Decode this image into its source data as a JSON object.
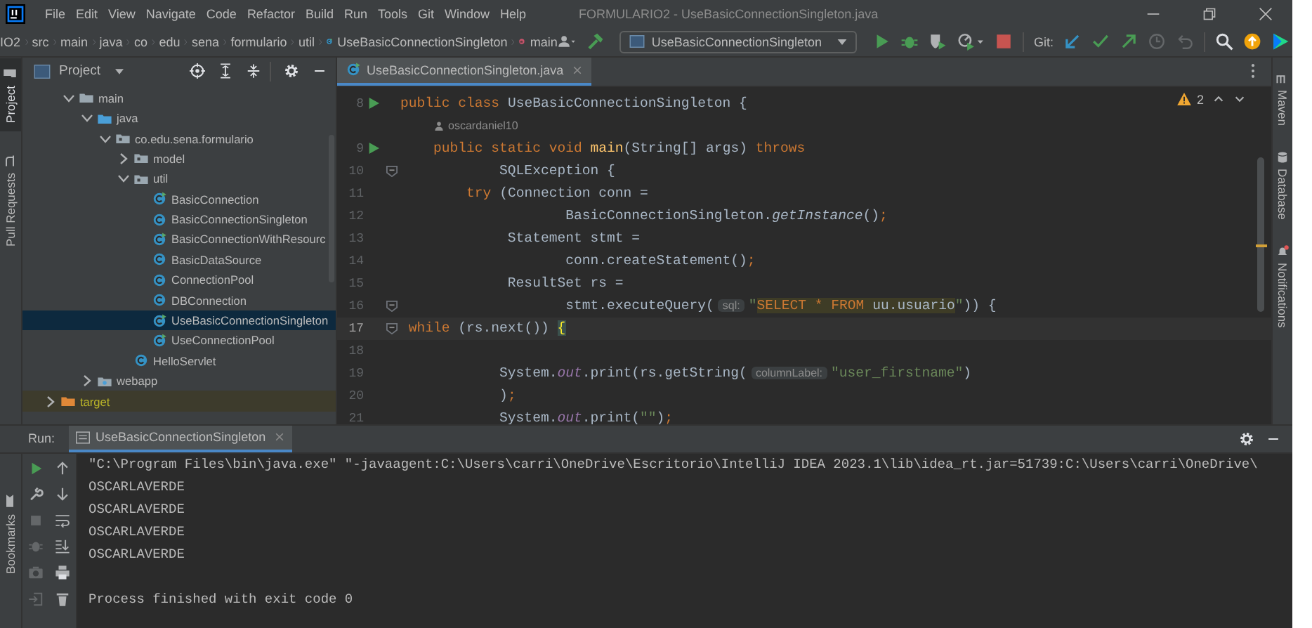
{
  "window": {
    "title": "FORMULARIO2 - UseBasicConnectionSingleton.java"
  },
  "menu": [
    "File",
    "Edit",
    "View",
    "Navigate",
    "Code",
    "Refactor",
    "Build",
    "Run",
    "Tools",
    "Git",
    "Window",
    "Help"
  ],
  "breadcrumbs": [
    {
      "label": "IO2",
      "kind": "path"
    },
    {
      "label": "src",
      "kind": "path"
    },
    {
      "label": "main",
      "kind": "path"
    },
    {
      "label": "java",
      "kind": "path"
    },
    {
      "label": "co",
      "kind": "path"
    },
    {
      "label": "edu",
      "kind": "path"
    },
    {
      "label": "sena",
      "kind": "path"
    },
    {
      "label": "formulario",
      "kind": "path"
    },
    {
      "label": "util",
      "kind": "path"
    },
    {
      "label": "UseBasicConnectionSingleton",
      "kind": "class"
    },
    {
      "label": "main",
      "kind": "method"
    }
  ],
  "run_config": {
    "label": "UseBasicConnectionSingleton"
  },
  "git": {
    "label": "Git:",
    "actions": [
      {
        "kind": "update",
        "disabled": false
      },
      {
        "kind": "commit",
        "disabled": false
      },
      {
        "kind": "push",
        "disabled": false
      },
      {
        "kind": "history",
        "disabled": true
      },
      {
        "kind": "rollback",
        "disabled": true
      }
    ]
  },
  "left_stripe": [
    {
      "label": "Project",
      "kind": "project",
      "selected": true
    },
    {
      "label": "Pull Requests",
      "kind": "pull_requests",
      "selected": false
    }
  ],
  "project": {
    "title": "Project",
    "tree": [
      {
        "children": [
          {
            "label": "main",
            "kind": "folder",
            "expanded": true,
            "selected": false,
            "children": [
              {
                "label": "java",
                "kind": "source_folder",
                "expanded": true,
                "selected": false,
                "children": [
                  {
                    "label": "co.edu.sena.formulario",
                    "kind": "package",
                    "expanded": true,
                    "selected": false,
                    "children": [
                      {
                        "label": "model",
                        "kind": "package",
                        "expanded": false,
                        "selected": false
                      },
                      {
                        "label": "util",
                        "kind": "package",
                        "expanded": true,
                        "selected": false,
                        "children": [
                          {
                            "label": "BasicConnection",
                            "kind": "runnable_class",
                            "selected": false
                          },
                          {
                            "label": "BasicConnectionSingleton",
                            "kind": "class",
                            "selected": false
                          },
                          {
                            "label": "BasicConnectionWithResourc",
                            "kind": "runnable_class",
                            "selected": false
                          },
                          {
                            "label": "BasicDataSource",
                            "kind": "class",
                            "selected": false
                          },
                          {
                            "label": "ConnectionPool",
                            "kind": "class",
                            "selected": false
                          },
                          {
                            "label": "DBConnection",
                            "kind": "class",
                            "selected": false
                          },
                          {
                            "label": "UseBasicConnectionSingleton",
                            "kind": "runnable_class",
                            "selected": true
                          },
                          {
                            "label": "UseConnectionPool",
                            "kind": "runnable_class",
                            "selected": false
                          }
                        ]
                      },
                      {
                        "label": "HelloServlet",
                        "kind": "class",
                        "selected": false
                      }
                    ]
                  }
                ]
              },
              {
                "label": "webapp",
                "kind": "web_folder",
                "expanded": false,
                "selected": false
              }
            ]
          }
        ]
      },
      {
        "label": "target",
        "kind": "excluded_folder",
        "expanded": false,
        "selected": false
      }
    ]
  },
  "editor": {
    "tabs": [
      {
        "label": "UseBasicConnectionSingleton.java",
        "selected": true
      }
    ],
    "warnings": "2",
    "lines": [
      {
        "kind": "code",
        "number": "8",
        "run": true,
        "fold": false,
        "current": false,
        "tokens": [
          {
            "text": "public class ",
            "kind": "kw"
          },
          {
            "text": "UseBasicConnectionSingleton {",
            "kind": "plain"
          }
        ]
      },
      {
        "kind": "author",
        "text": "oscardaniel10"
      },
      {
        "kind": "code",
        "number": "9",
        "run": true,
        "fold": false,
        "current": false,
        "tokens": [
          {
            "text": "    public static void ",
            "kind": "kw"
          },
          {
            "text": "main",
            "kind": "method"
          },
          {
            "text": "(String[] args) ",
            "kind": "plain"
          },
          {
            "text": "throws",
            "kind": "kw"
          }
        ]
      },
      {
        "kind": "code",
        "number": "10",
        "run": false,
        "fold": true,
        "current": false,
        "tokens": [
          {
            "text": "            SQLException {",
            "kind": "plain"
          }
        ]
      },
      {
        "kind": "code",
        "number": "11",
        "run": false,
        "fold": false,
        "current": false,
        "tokens": [
          {
            "text": "        try ",
            "kind": "kw"
          },
          {
            "text": "(Connection conn =",
            "kind": "plain"
          }
        ]
      },
      {
        "kind": "code",
        "number": "12",
        "run": false,
        "fold": false,
        "current": false,
        "tokens": [
          {
            "text": "                    BasicConnectionSingleton.",
            "kind": "plain"
          },
          {
            "text": "getInstance",
            "kind": "italic"
          },
          {
            "text": "()",
            "kind": "plain"
          },
          {
            "text": ";",
            "kind": "kw"
          }
        ]
      },
      {
        "kind": "code",
        "number": "13",
        "run": false,
        "fold": false,
        "current": false,
        "tokens": [
          {
            "text": "             Statement stmt =",
            "kind": "plain"
          }
        ]
      },
      {
        "kind": "code",
        "number": "14",
        "run": false,
        "fold": false,
        "current": false,
        "tokens": [
          {
            "text": "                    conn.createStatement()",
            "kind": "plain"
          },
          {
            "text": ";",
            "kind": "kw"
          }
        ]
      },
      {
        "kind": "code",
        "number": "15",
        "run": false,
        "fold": false,
        "current": false,
        "tokens": [
          {
            "text": "             ResultSet rs =",
            "kind": "plain"
          }
        ]
      },
      {
        "kind": "code",
        "number": "16",
        "run": false,
        "fold": true,
        "current": false,
        "tokens": [
          {
            "text": "                    stmt.executeQuery(",
            "kind": "plain"
          },
          {
            "text": "sql:",
            "kind": "hint"
          },
          {
            "text": "\"",
            "kind": "string"
          },
          {
            "text": "SELECT * FROM",
            "kind": "sql_kw"
          },
          {
            "text": " uu.usuario",
            "kind": "sql"
          },
          {
            "text": "\"",
            "kind": "string"
          },
          {
            "text": ")) {",
            "kind": "plain"
          }
        ]
      },
      {
        "kind": "code",
        "number": "17",
        "run": false,
        "fold": true,
        "current": true,
        "tokens": [
          {
            "text": " while ",
            "kind": "kw"
          },
          {
            "text": "(rs.next()) ",
            "kind": "plain"
          },
          {
            "text": "{",
            "kind": "brace"
          }
        ]
      },
      {
        "kind": "code",
        "number": "18",
        "run": false,
        "fold": false,
        "current": false
      },
      {
        "kind": "code",
        "number": "19",
        "run": false,
        "fold": false,
        "current": false,
        "tokens": [
          {
            "text": "            System.",
            "kind": "plain"
          },
          {
            "text": "out",
            "kind": "field"
          },
          {
            "text": ".print(rs.getString(",
            "kind": "plain"
          },
          {
            "text": "columnLabel:",
            "kind": "hint"
          },
          {
            "text": "\"user_firstname\"",
            "kind": "string"
          },
          {
            "text": ")",
            "kind": "plain"
          }
        ]
      },
      {
        "kind": "code",
        "number": "20",
        "run": false,
        "fold": false,
        "current": false,
        "tokens": [
          {
            "text": "            )",
            "kind": "plain"
          },
          {
            "text": ";",
            "kind": "kw"
          }
        ]
      },
      {
        "kind": "code",
        "number": "21",
        "run": false,
        "fold": false,
        "current": false,
        "tokens": [
          {
            "text": "            System.",
            "kind": "plain"
          },
          {
            "text": "out",
            "kind": "field"
          },
          {
            "text": ".print(",
            "kind": "plain"
          },
          {
            "text": "\"\"",
            "kind": "string"
          },
          {
            "text": ")",
            "kind": "plain"
          },
          {
            "text": ";",
            "kind": "kw"
          }
        ]
      }
    ]
  },
  "right_stripe": [
    {
      "label": "Maven",
      "kind": "maven"
    },
    {
      "label": "Database",
      "kind": "database"
    },
    {
      "label": "Notifications",
      "kind": "notifications"
    }
  ],
  "run": {
    "label": "Run:",
    "tabs": [
      {
        "label": "UseBasicConnectionSingleton",
        "selected": true
      }
    ],
    "tools_left": [
      {
        "kind": "rerun",
        "disabled": false
      },
      {
        "kind": "wrench",
        "disabled": false
      },
      {
        "kind": "stop",
        "disabled": true
      },
      {
        "kind": "bug",
        "disabled": true
      },
      {
        "kind": "camera",
        "disabled": true
      },
      {
        "kind": "exit",
        "disabled": true
      }
    ],
    "tools_right": [
      {
        "kind": "up",
        "disabled": false
      },
      {
        "kind": "down",
        "disabled": false
      },
      {
        "kind": "wrap",
        "disabled": false
      },
      {
        "kind": "scroll_end",
        "disabled": false
      },
      {
        "kind": "print",
        "disabled": false
      },
      {
        "kind": "trash",
        "disabled": false
      }
    ],
    "output": [
      {
        "kind": "command",
        "text": "\"C:\\Program Files\\bin\\java.exe\" \"-javaagent:C:\\Users\\carri\\OneDrive\\Escritorio\\IntelliJ IDEA 2023.1\\lib\\idea_rt.jar=51739:C:\\Users\\carri\\OneDrive\\"
      },
      {
        "kind": "text",
        "text": "OSCARLAVERDE"
      },
      {
        "kind": "text",
        "text": "OSCARLAVERDE"
      },
      {
        "kind": "text",
        "text": "OSCARLAVERDE"
      },
      {
        "kind": "text",
        "text": "OSCARLAVERDE"
      },
      {
        "kind": "status",
        "text": "Process finished with exit code 0"
      }
    ]
  },
  "bottom_stripe": [
    {
      "label": "Bookmarks"
    }
  ]
}
